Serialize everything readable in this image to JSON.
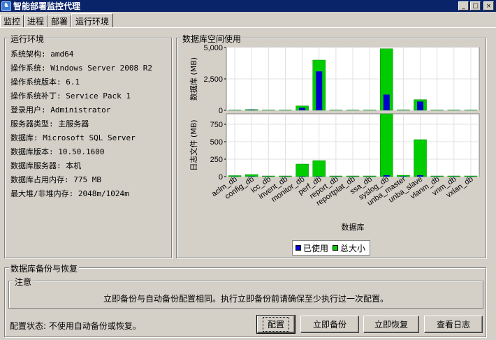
{
  "window": {
    "title": "智能部署监控代理",
    "icon_glyph": "♞",
    "buttons": {
      "minimize": "_",
      "maximize": "□",
      "close": "×"
    }
  },
  "tabs": [
    {
      "label": "监控",
      "active": false
    },
    {
      "label": "进程",
      "active": false
    },
    {
      "label": "部署",
      "active": false
    },
    {
      "label": "运行环境",
      "active": true
    }
  ],
  "runtime": {
    "title": "运行环境",
    "rows": [
      "系统架构: amd64",
      "操作系统: Windows Server 2008 R2",
      "操作系统版本: 6.1",
      "操作系统补丁: Service Pack 1",
      "登录用户: Administrator",
      "服务器类型: 主服务器",
      "数据库: Microsoft SQL Server",
      "数据库版本: 10.50.1600",
      "数据库服务器: 本机",
      "数据库占用内存: 775 MB",
      "最大堆/非堆内存: 2048m/1024m"
    ]
  },
  "chart_section": {
    "title": "数据库空间使用"
  },
  "chart_data": {
    "type": "bar",
    "layout": "stacked-subplots",
    "xlabel": "数据库",
    "categories": [
      "aclm_db",
      "config_db",
      "icc_db",
      "invent_db",
      "monitor_db",
      "perf_db",
      "report_db",
      "reportplat_db",
      "ssa_db",
      "syslog_db",
      "unba_master",
      "unba_slave",
      "vlanm_db",
      "vnm_db",
      "vxlan_db"
    ],
    "colors": {
      "used": "#0000cc",
      "total": "#00cc00"
    },
    "legend": {
      "position": "bottom",
      "items": [
        "已使用",
        "总大小"
      ]
    },
    "subplots": [
      {
        "ylabel": "数据库 (MB)",
        "ylim": [
          0,
          5000
        ],
        "yticks": [
          "0",
          "2,500",
          "5,000"
        ],
        "series": [
          {
            "name": "已使用",
            "values": [
              10,
              40,
              5,
              5,
              200,
              3100,
              5,
              5,
              5,
              1250,
              10,
              700,
              5,
              5,
              5
            ]
          },
          {
            "name": "总大小",
            "values": [
              20,
              60,
              20,
              20,
              350,
              4000,
              20,
              20,
              20,
              4900,
              30,
              850,
              20,
              20,
              20
            ]
          }
        ]
      },
      {
        "ylabel": "日志文件 (MB)",
        "ylim": [
          0,
          900
        ],
        "yticks": [
          "0",
          "250",
          "500",
          "750"
        ],
        "series": [
          {
            "name": "已使用",
            "values": [
              2,
              5,
              2,
              2,
              5,
              5,
              2,
              2,
              2,
              20,
              5,
              20,
              2,
              2,
              2
            ]
          },
          {
            "name": "总大小",
            "values": [
              15,
              30,
              10,
              10,
              180,
              230,
              10,
              10,
              10,
              900,
              20,
              530,
              10,
              10,
              10
            ]
          }
        ]
      }
    ]
  },
  "backup": {
    "title": "数据库备份与恢复",
    "note_title": "注意",
    "note_text": "立即备份与自动备份配置相同。执行立即备份前请确保至少执行过一次配置。",
    "status": "配置状态: 不使用自动备份或恢复。",
    "buttons": {
      "configure": "配置",
      "backup_now": "立即备份",
      "restore_now": "立即恢复",
      "view_log": "查看日志"
    }
  }
}
